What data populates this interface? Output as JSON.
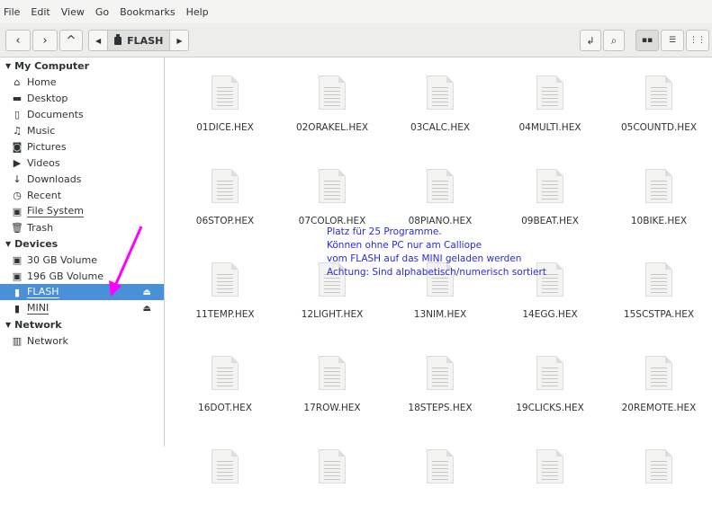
{
  "menu": [
    "File",
    "Edit",
    "View",
    "Go",
    "Bookmarks",
    "Help"
  ],
  "path": {
    "current": "FLASH"
  },
  "sidebar": {
    "my_computer": "My Computer",
    "places": [
      {
        "label": "Home",
        "icon": "home-icon"
      },
      {
        "label": "Desktop",
        "icon": "folder-icon"
      },
      {
        "label": "Documents",
        "icon": "document-icon"
      },
      {
        "label": "Music",
        "icon": "music-icon"
      },
      {
        "label": "Pictures",
        "icon": "camera-icon"
      },
      {
        "label": "Videos",
        "icon": "video-icon"
      },
      {
        "label": "Downloads",
        "icon": "download-icon"
      },
      {
        "label": "Recent",
        "icon": "clock-icon"
      },
      {
        "label": "File System",
        "icon": "drive-icon"
      },
      {
        "label": "Trash",
        "icon": "trash-icon"
      }
    ],
    "devices_label": "Devices",
    "devices": [
      {
        "label": "30 GB Volume"
      },
      {
        "label": "196 GB Volume"
      },
      {
        "label": "FLASH",
        "selected": true
      },
      {
        "label": "MINI"
      }
    ],
    "network_label": "Network",
    "network": [
      {
        "label": "Network"
      }
    ]
  },
  "files": [
    "01DICE.HEX",
    "02ORAKEL.HEX",
    "03CALC.HEX",
    "04MULTI.HEX",
    "05COUNTD.HEX",
    "06STOP.HEX",
    "07COLOR.HEX",
    "08PIANO.HEX",
    "09BEAT.HEX",
    "10BIKE.HEX",
    "11TEMP.HEX",
    "12LIGHT.HEX",
    "13NIM.HEX",
    "14EGG.HEX",
    "15SCSTPA.HEX",
    "16DOT.HEX",
    "17ROW.HEX",
    "18STEPS.HEX",
    "19CLICKS.HEX",
    "20REMOTE.HEX",
    "",
    "",
    "",
    "",
    ""
  ],
  "note": [
    "Platz für 25 Programme.",
    "Können ohne PC nur am Calliope",
    "vom FLASH auf das MINI geladen werden",
    "Achtung: Sind alphabetisch/numerisch sortiert"
  ],
  "colors": {
    "selection": "#4a90d9",
    "annotation": "#2a2ae0",
    "arrow": "#ff00ff"
  }
}
